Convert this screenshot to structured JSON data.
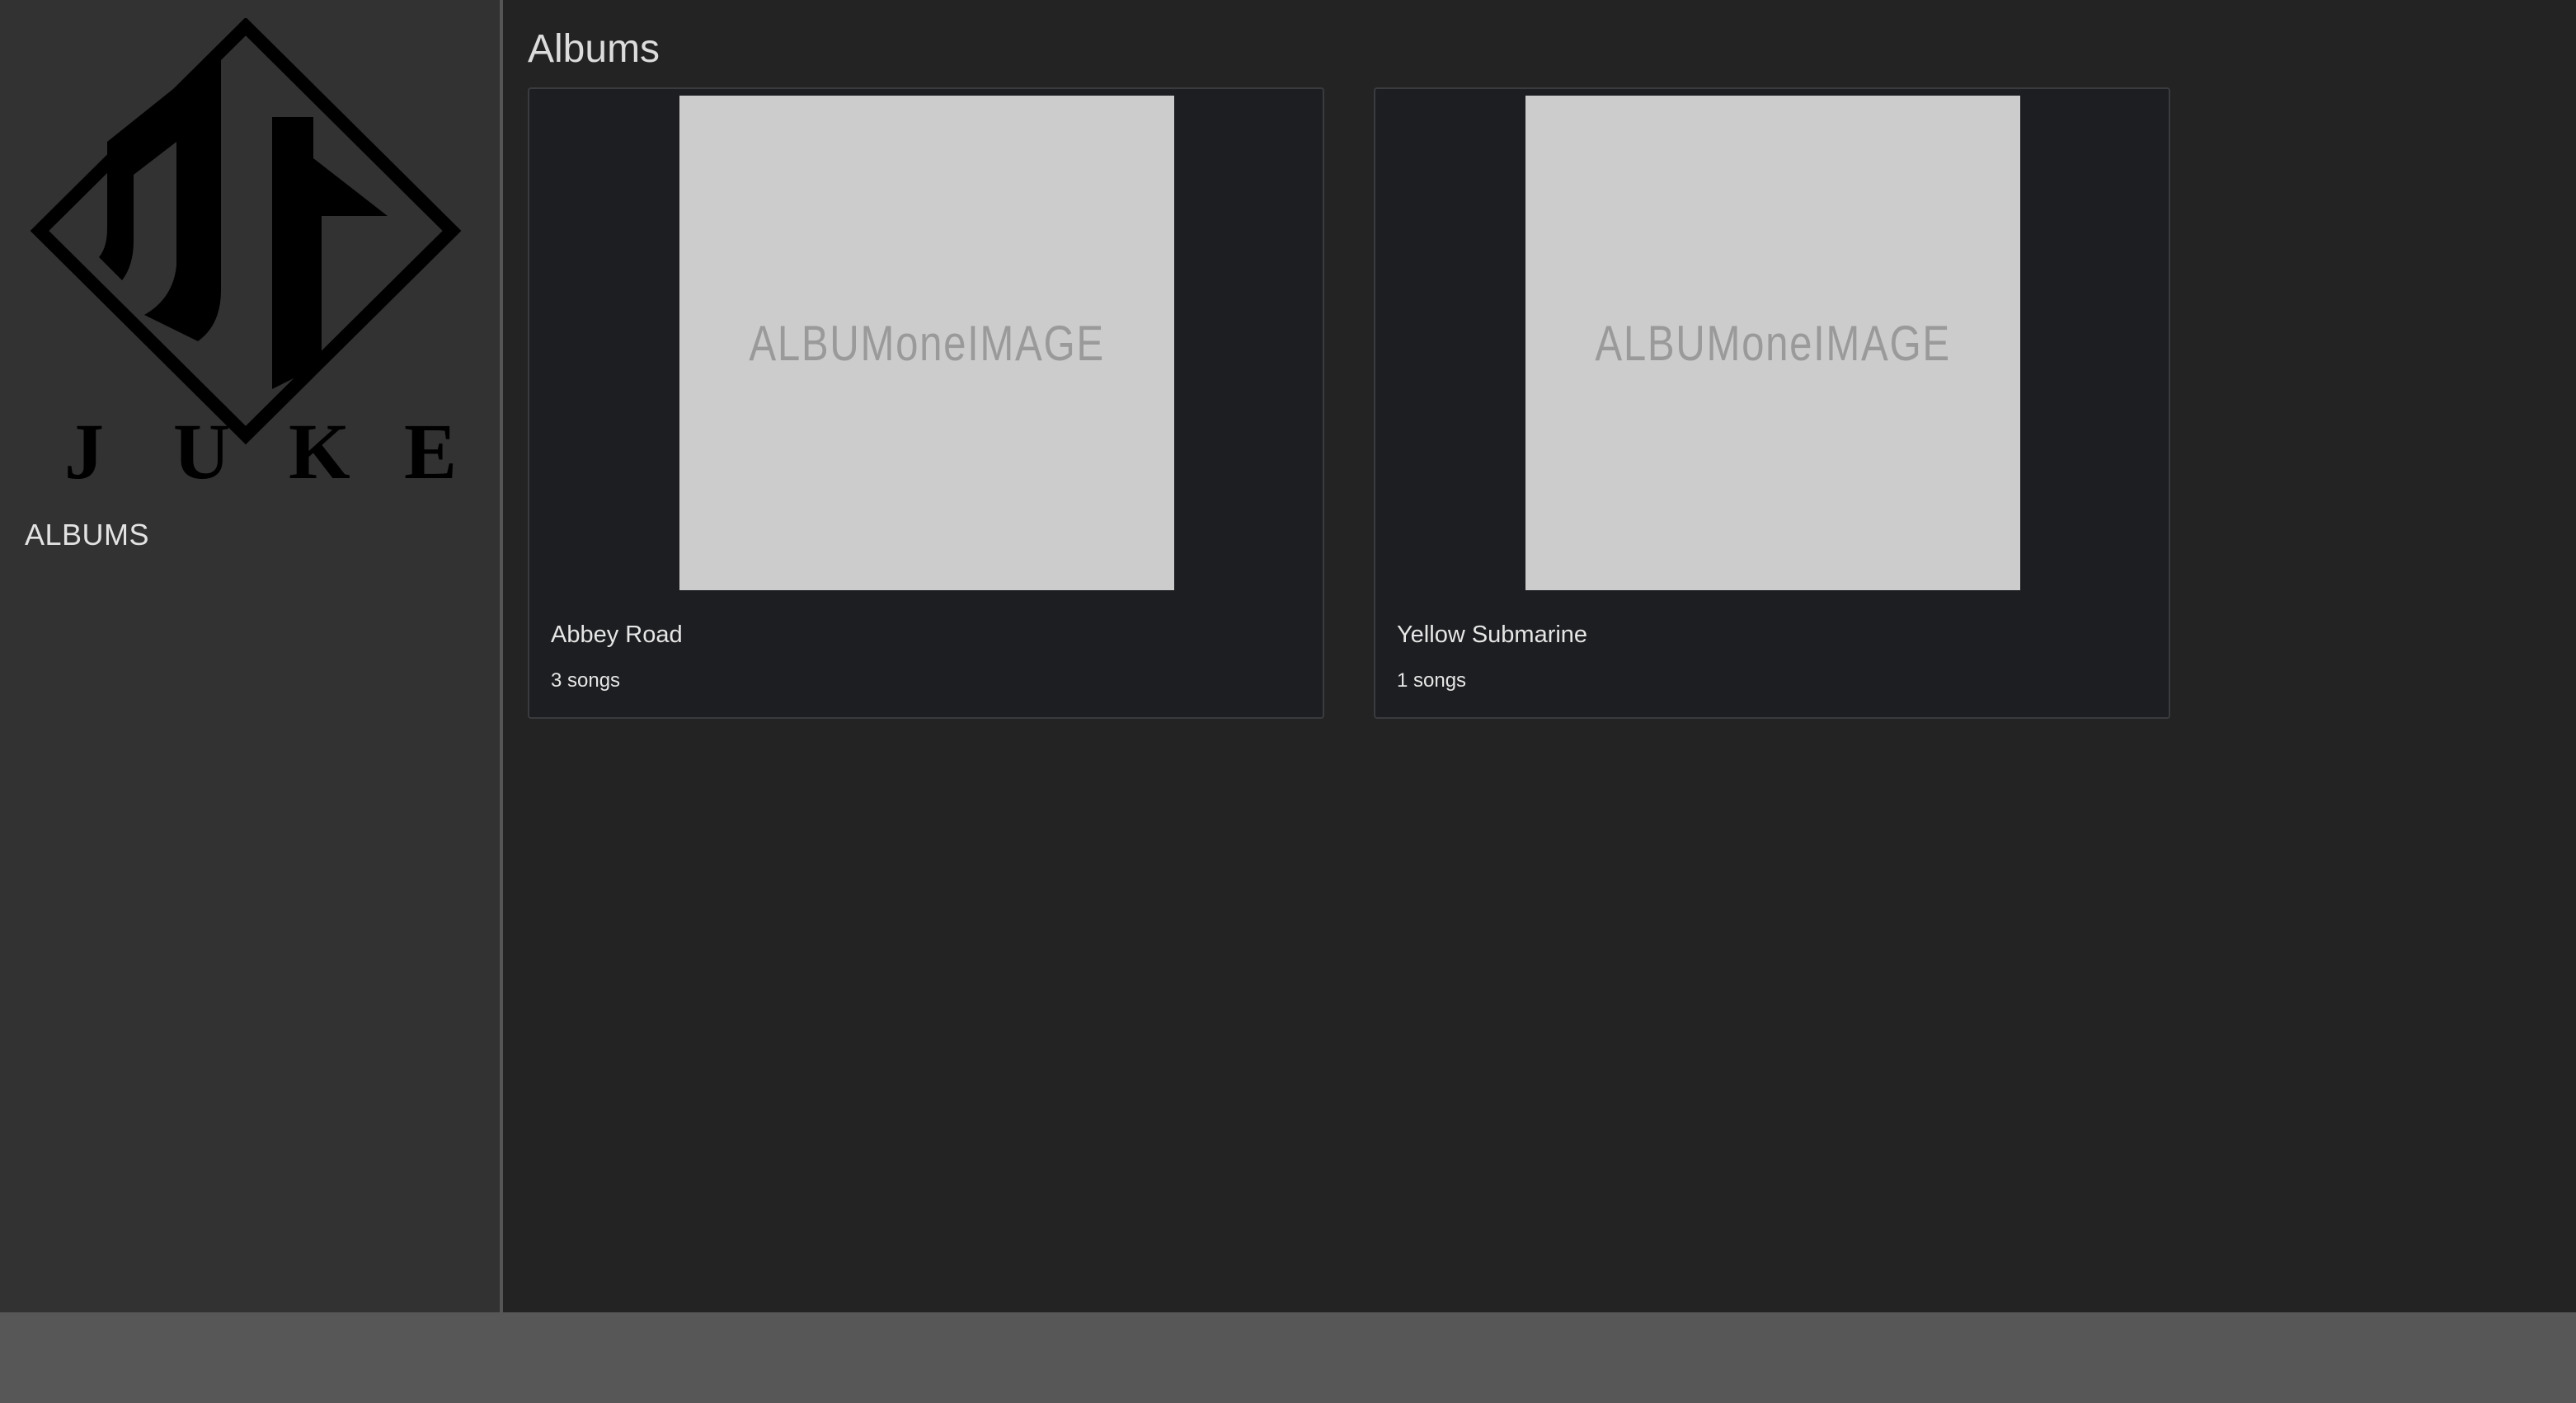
{
  "sidebar": {
    "logo": {
      "text": "JUKE",
      "letters": [
        "J",
        "U",
        "K",
        "E"
      ]
    },
    "nav": [
      {
        "label": "ALBUMS"
      }
    ]
  },
  "main": {
    "title": "Albums",
    "albums": [
      {
        "name": "Abbey Road",
        "song_count": "3 songs",
        "image_text": "ALBUMoneIMAGE"
      },
      {
        "name": "Yellow Submarine",
        "song_count": "1 songs",
        "image_text": "ALBUMoneIMAGE"
      }
    ]
  },
  "colors": {
    "sidebar_bg": "#323232",
    "main_bg": "#232323",
    "card_bg": "#1d1e21",
    "album_art_bg": "#cccccc",
    "player_bar_bg": "#575757"
  }
}
